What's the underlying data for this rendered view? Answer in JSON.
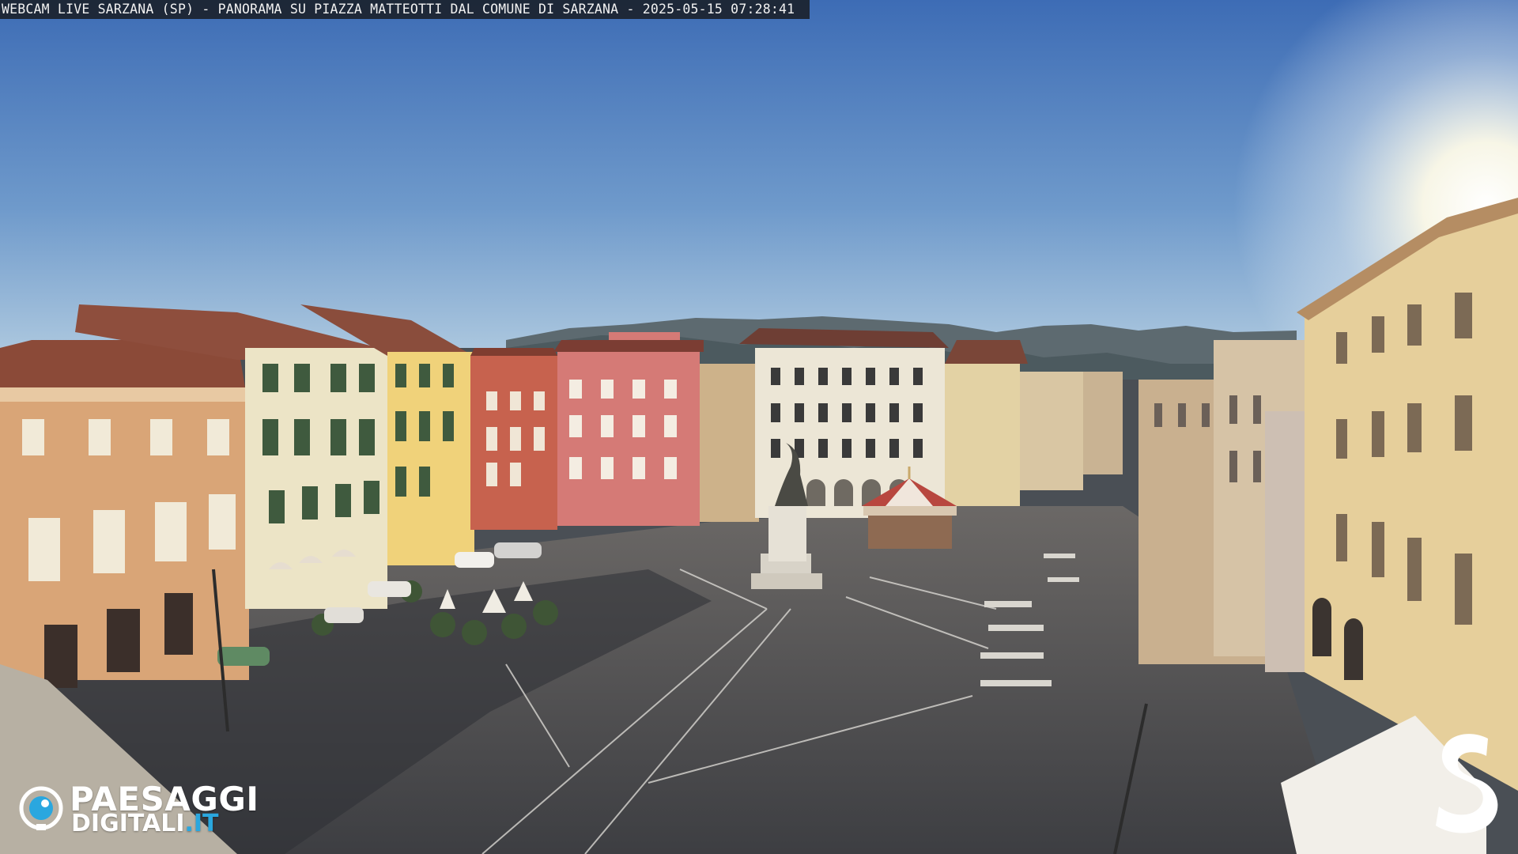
{
  "overlay": {
    "title": "WEBCAM LIVE SARZANA (SP) - PANORAMA SU PIAZZA MATTEOTTI DAL COMUNE DI SARZANA - 2025-05-15  07:28:41"
  },
  "logo_left": {
    "line1": "PAESAGGI",
    "line2_main": "DIGITALI",
    "line2_accent": ".IT",
    "icon": "camera-lens-icon"
  },
  "logo_right": {
    "icon": "s-brand-icon"
  },
  "colors": {
    "sky_top": "#3f6fb8",
    "sky_bottom": "#a9c3dc",
    "plaza": "#5a5a5c",
    "accent_blue": "#2aa7df"
  }
}
